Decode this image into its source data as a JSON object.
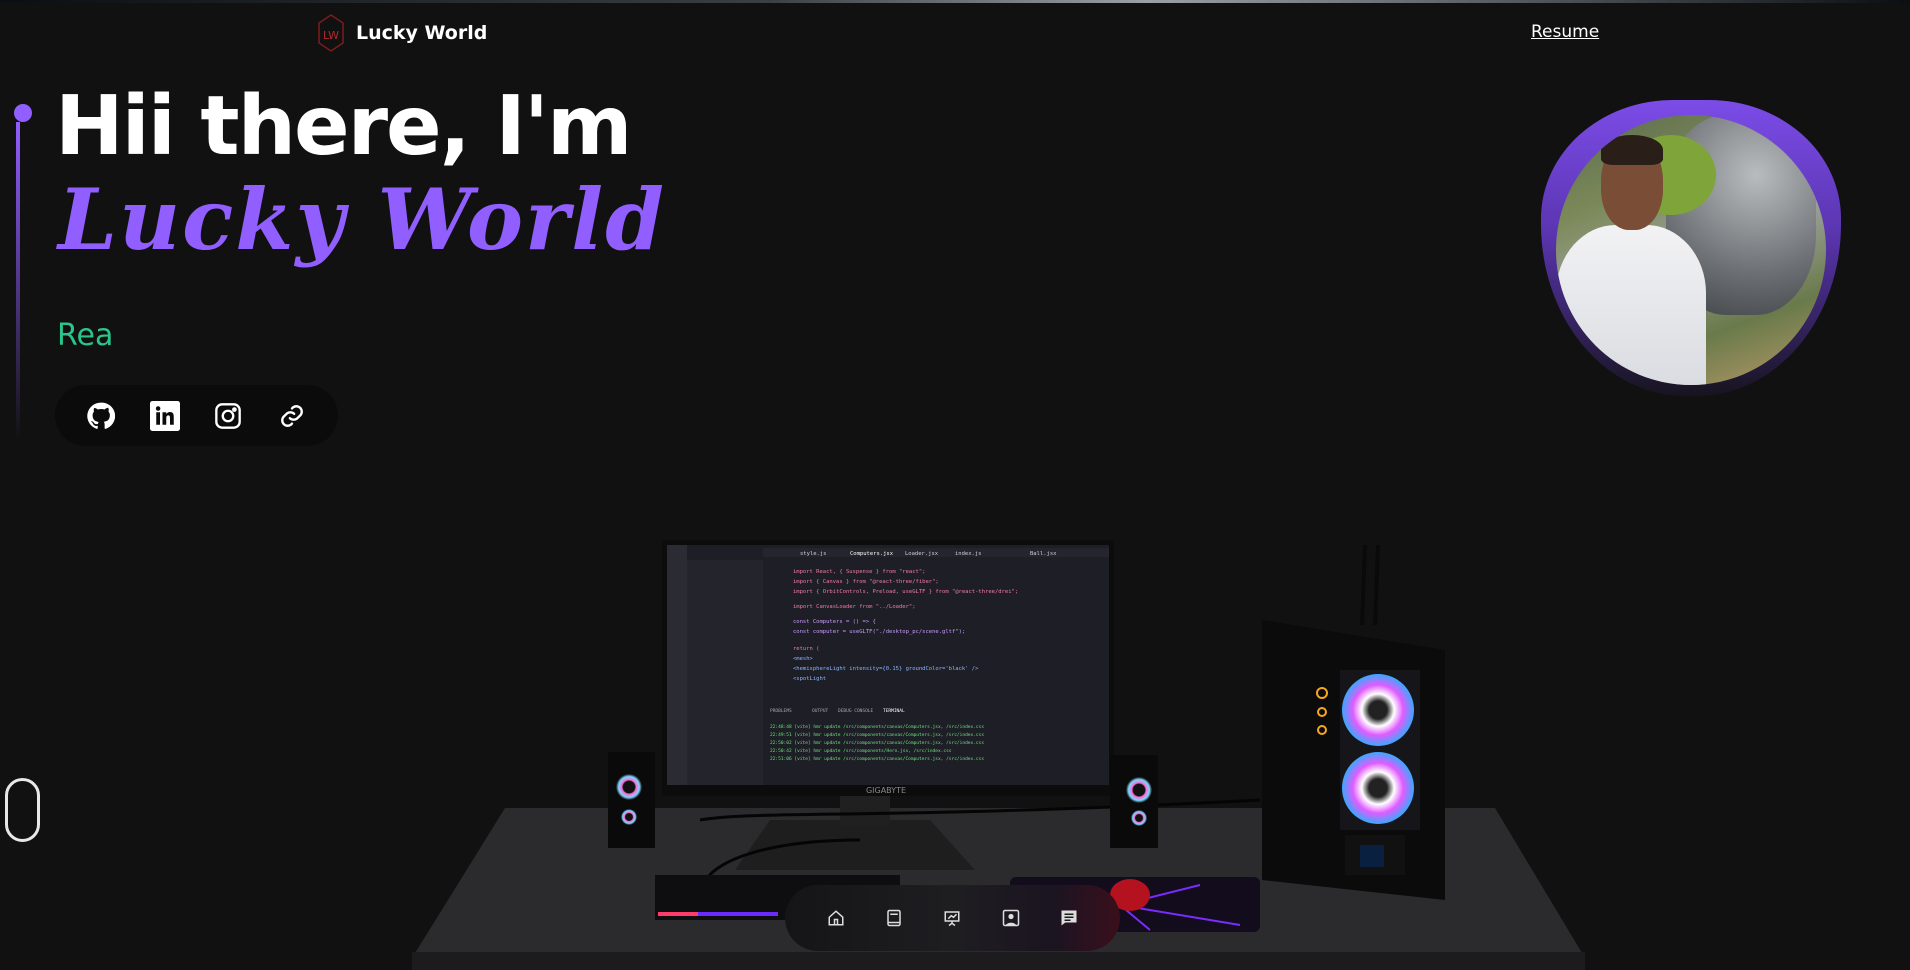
{
  "header": {
    "brand": "Lucky World",
    "logo_text": "LW",
    "resume_link": "Resume"
  },
  "hero": {
    "greeting": "Hii there, I'm",
    "name": "Lucky World",
    "typed_text": "Rea",
    "accent_color": "#915EFF",
    "typed_color": "#2bc48a"
  },
  "social": [
    {
      "icon": "github-icon"
    },
    {
      "icon": "linkedin-icon"
    },
    {
      "icon": "instagram-icon"
    },
    {
      "icon": "link-icon"
    }
  ],
  "scene": {
    "monitor_brand": "GIGABYTE",
    "editor_tabs": [
      "style.js",
      "Computers.jsx",
      "Loader.jsx",
      "index.js",
      "Ball.jsx"
    ],
    "code_lines": [
      "import React, { Suspense } from \"react\";",
      "import { Canvas } from \"@react-three/fiber\";",
      "import { OrbitControls, Preload, useGLTF } from \"@react-three/drei\";",
      "import CanvasLoader from \"../Loader\";",
      "const Computers = () => {",
      "  const computer = useGLTF(\"./desktop_pc/scene.gltf\");",
      "  return (",
      "    <mesh>",
      "      <hemisphereLight intensity={0.15} groundColor='black' />",
      "      <spotLight"
    ],
    "terminal_tabs": [
      "PROBLEMS",
      "OUTPUT",
      "DEBUG CONSOLE",
      "TERMINAL"
    ],
    "terminal_lines": [
      "22:48:48 [vite] hmr update /src/components/canvas/Computers.jsx, /src/index.css",
      "22:49:51 [vite] hmr update /src/components/canvas/Computers.jsx, /src/index.css",
      "22:50:02 [vite] hmr update /src/components/canvas/Computers.jsx, /src/index.css",
      "22:50:42 [vite] hmr update /src/components/Hero.jsx, /src/index.css",
      "22:51:06 [vite] hmr update /src/components/canvas/Computers.jsx, /src/index.css"
    ]
  },
  "bottom_nav": [
    {
      "icon": "home-icon"
    },
    {
      "icon": "book-icon"
    },
    {
      "icon": "presentation-icon"
    },
    {
      "icon": "contact-card-icon"
    },
    {
      "icon": "message-icon"
    }
  ]
}
